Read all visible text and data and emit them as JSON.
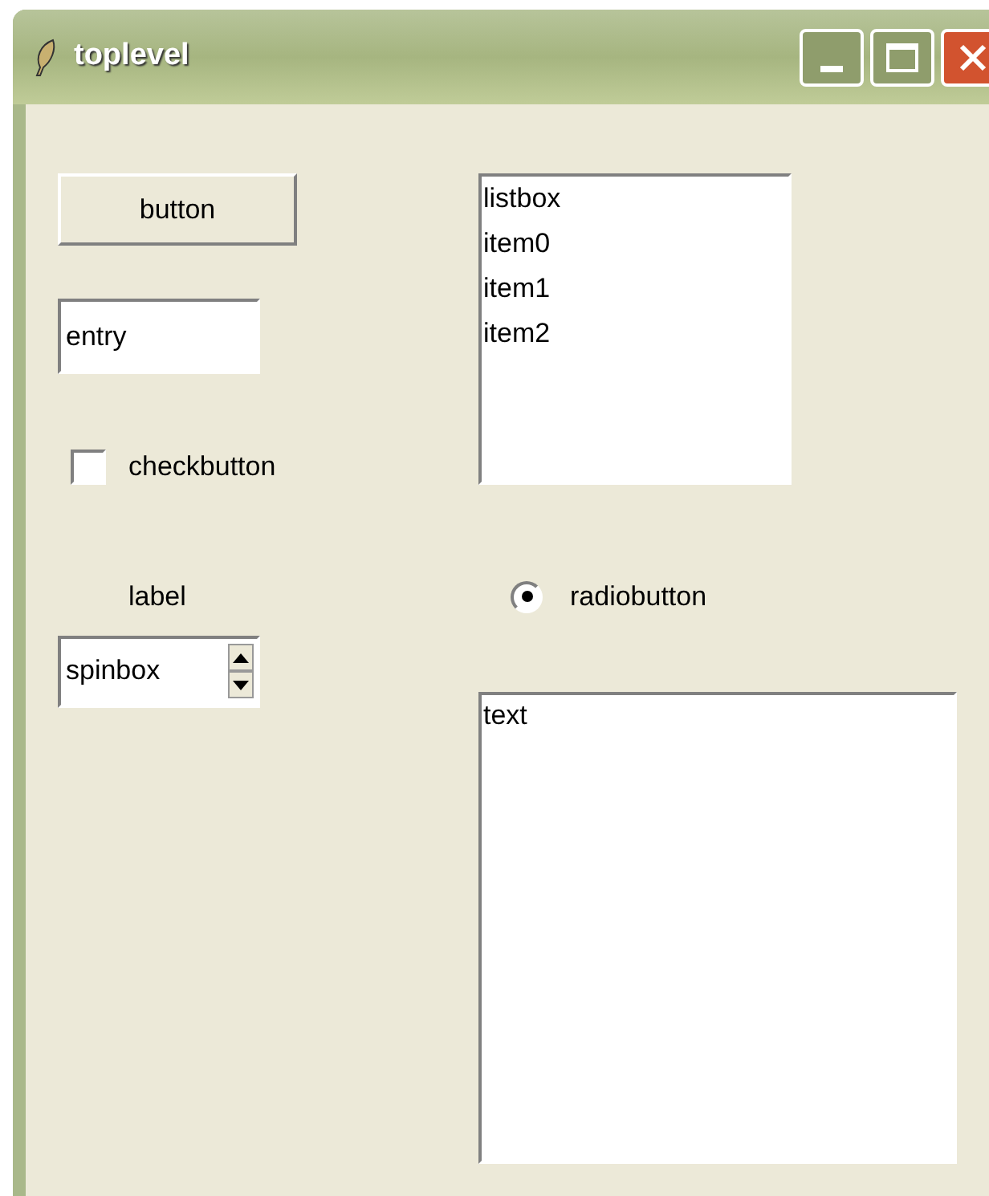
{
  "window": {
    "title": "toplevel"
  },
  "button": {
    "label": "button"
  },
  "entry": {
    "value": "entry"
  },
  "checkbutton": {
    "label": "checkbutton",
    "checked": false
  },
  "label": "label",
  "spinbox": {
    "value": "spinbox"
  },
  "listbox": {
    "items": [
      {
        "text": "listbox",
        "selected": false
      },
      {
        "text": "item0",
        "selected": false
      },
      {
        "text": "item1",
        "selected": false
      },
      {
        "text": "item2",
        "selected": false
      }
    ]
  },
  "radiobutton": {
    "label": "radiobutton",
    "selected": true
  },
  "text": {
    "value": "text"
  }
}
